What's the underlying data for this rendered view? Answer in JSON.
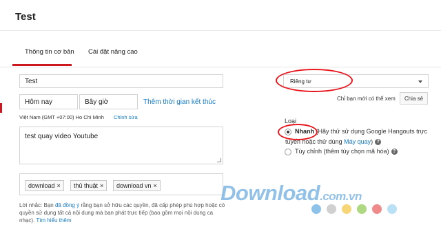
{
  "header": {
    "title": "Test"
  },
  "tabs": [
    {
      "label": "Thông tin cơ bản",
      "active": true
    },
    {
      "label": "Cài đặt nâng cao",
      "active": false
    }
  ],
  "form": {
    "title_value": "Test",
    "date_value": "Hôm nay",
    "time_value": "Bây giờ",
    "add_end_time_link": "Thêm thời gian kết thúc",
    "timezone": "Việt Nam (GMT +07:00) Ho Chi Minh",
    "edit_link": "Chỉnh sửa",
    "description": "test quay video Youtube",
    "tags": [
      {
        "label": "download"
      },
      {
        "label": "thủ thuật"
      },
      {
        "label": "download vn"
      }
    ],
    "tag_remove": "×",
    "note_lead": "Lời nhắc: Bạn ",
    "note_link_agree": "đã đồng ý",
    "note_rest": " rằng bạn sở hữu các quyền, đã cấp phép phù hợp hoặc có quyền sử dụng tất cả nội dung mà bạn phát trực tiếp (bao gồm mọi nội dung ca nhạc). ",
    "note_link_more": "Tìm hiểu thêm"
  },
  "privacy": {
    "selected": "Riêng tư",
    "hint": "Chỉ bạn mới có thể xem",
    "share_button": "Chia sẻ"
  },
  "stream_type": {
    "label": "Loại",
    "option_fast_name": "Nhanh",
    "option_fast_desc": " (Hãy thử sử dụng Google Hangouts trực",
    "option_fast_desc2": "tuyến hoặc thử dùng ",
    "option_fast_link": "Máy quay",
    "option_fast_end": ")",
    "option_custom_name": "Tùy chỉnh",
    "option_custom_desc": " (thêm tùy chọn mã hóa)",
    "help_glyph": "?",
    "selected": "fast"
  },
  "watermark": {
    "text": "Download",
    "suffix": ".com.vn"
  },
  "colors": {
    "accent_red": "#cc181e",
    "link_blue": "#167ac6",
    "annotation_red": "#e8151b",
    "watermark_dots": [
      "#5fa8e0",
      "#bcbcbc",
      "#f4c542",
      "#8cc84b",
      "#e85a5a",
      "#9bd3f1"
    ]
  }
}
